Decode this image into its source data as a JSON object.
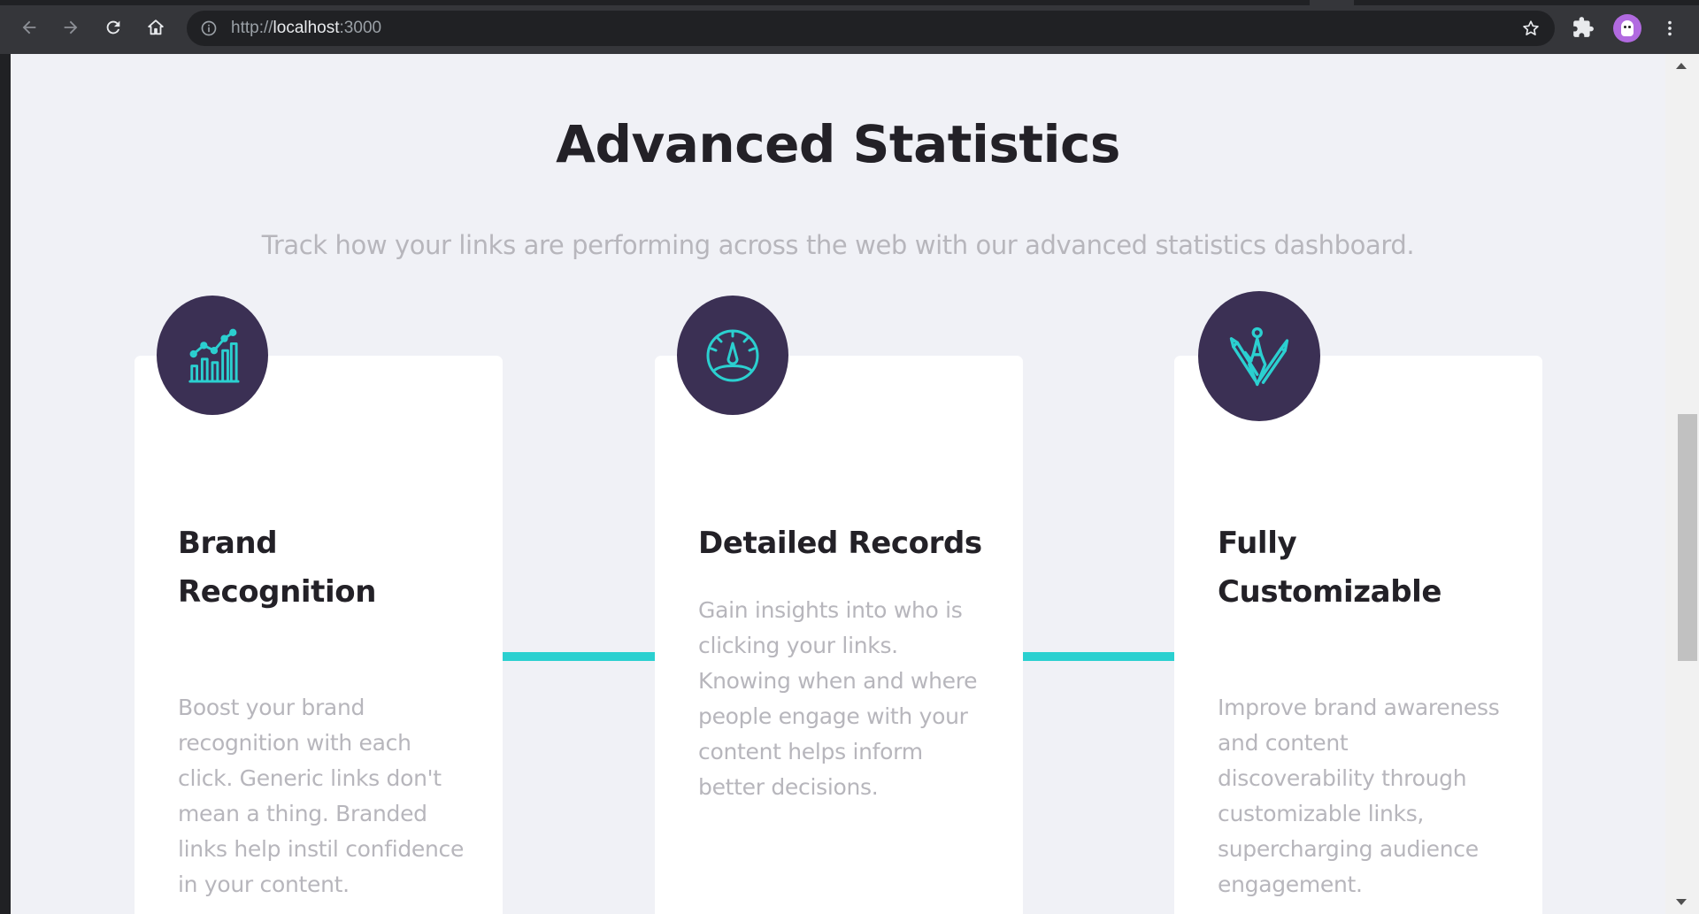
{
  "browser": {
    "url_prefix": "http://",
    "url_host": "localhost",
    "url_port": ":3000",
    "icons": {
      "back": "back-arrow-icon",
      "forward": "forward-arrow-icon",
      "reload": "reload-icon",
      "home": "home-icon",
      "info": "info-icon",
      "bookmark": "star-icon",
      "extensions": "puzzle-icon",
      "menu": "kebab-menu-icon"
    }
  },
  "section": {
    "title": "Advanced Statistics",
    "subtitle": "Track how your links are performing across the web with our advanced statistics dashboard."
  },
  "cards": [
    {
      "icon": "chart-icon",
      "title": "Brand Recognition",
      "text": "Boost your brand recognition with each click. Generic links don't mean a thing. Branded links help instil confidence in your content."
    },
    {
      "icon": "gauge-icon",
      "title": "Detailed Records",
      "text": "Gain insights into who is clicking your links. Knowing when and where people engage with your content helps inform better decisions."
    },
    {
      "icon": "pens-icon",
      "title": "Fully Customizable",
      "text": "Improve brand awareness and content discoverability through customizable links, supercharging audience engagement."
    }
  ],
  "colors": {
    "accent": "#2bd0d0",
    "icon_bg": "#3b3054",
    "page_bg": "#f0f1f6",
    "heading": "#232127",
    "muted_text": "#b7b6bc"
  }
}
